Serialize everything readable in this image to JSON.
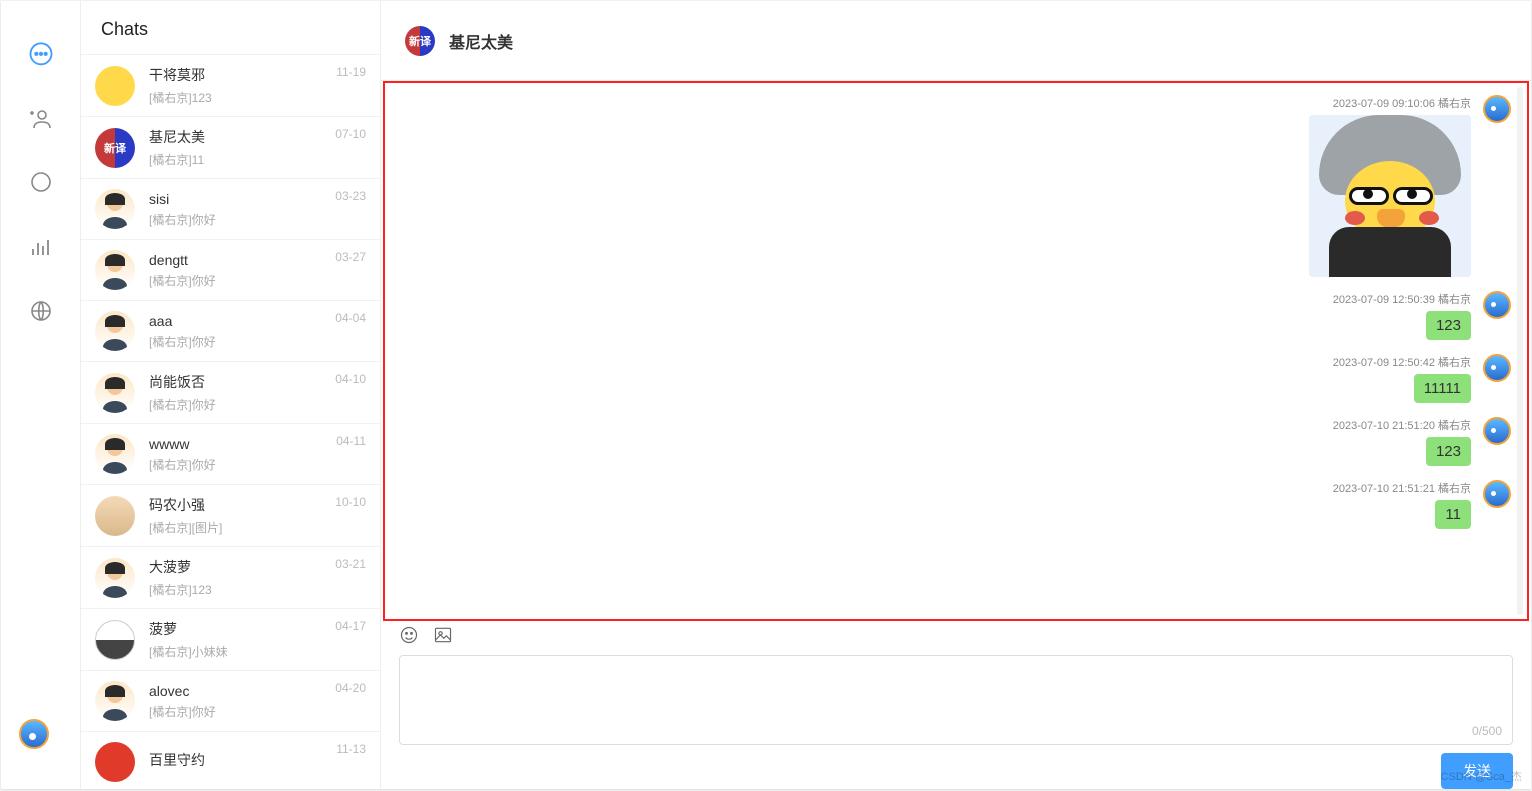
{
  "rail": {
    "icons": [
      "chat-bubble",
      "add-contact",
      "search-bubble",
      "stats",
      "globe"
    ]
  },
  "sidebar": {
    "title": "Chats",
    "items": [
      {
        "name": "干将莫邪",
        "preview": "[橘右京]123",
        "time": "11-19",
        "avatar_class": "av-yellow"
      },
      {
        "name": "基尼太美",
        "preview": "[橘右京]11",
        "time": "07-10",
        "avatar_class": "av-split",
        "avatar_text": "新译"
      },
      {
        "name": "sisi",
        "preview": "[橘右京]你好",
        "time": "03-23",
        "avatar_class": "av-person"
      },
      {
        "name": "dengtt",
        "preview": "[橘右京]你好",
        "time": "03-27",
        "avatar_class": "av-person"
      },
      {
        "name": "aaa",
        "preview": "[橘右京]你好",
        "time": "04-04",
        "avatar_class": "av-person"
      },
      {
        "name": "尚能饭否",
        "preview": "[橘右京]你好",
        "time": "04-10",
        "avatar_class": "av-person"
      },
      {
        "name": "wwww",
        "preview": "[橘右京]你好",
        "time": "04-11",
        "avatar_class": "av-person"
      },
      {
        "name": "码农小强",
        "preview": "[橘右京][图片]",
        "time": "10-10",
        "avatar_class": "av-cat"
      },
      {
        "name": "大菠萝",
        "preview": "[橘右京]123",
        "time": "03-21",
        "avatar_class": "av-person"
      },
      {
        "name": "菠萝",
        "preview": "[橘右京]小妹妹",
        "time": "04-17",
        "avatar_class": "av-half"
      },
      {
        "name": "alovec",
        "preview": "[橘右京]你好",
        "time": "04-20",
        "avatar_class": "av-person"
      },
      {
        "name": "百里守约",
        "preview": "",
        "time": "11-13",
        "avatar_class": "av-red"
      }
    ]
  },
  "main": {
    "title": "基尼太美",
    "header_avatar_class": "av-split",
    "header_avatar_text": "新译",
    "messages": [
      {
        "meta": "2023-07-09 09:10:06 橘右京",
        "kind": "image"
      },
      {
        "meta": "2023-07-09 12:50:39 橘右京",
        "kind": "text",
        "text": "123"
      },
      {
        "meta": "2023-07-09 12:50:42 橘右京",
        "kind": "text",
        "text": "11111"
      },
      {
        "meta": "2023-07-10 21:51:20 橘右京",
        "kind": "text",
        "text": "123"
      },
      {
        "meta": "2023-07-10 21:51:21 橘右京",
        "kind": "text",
        "text": "11"
      }
    ],
    "counter": "0/500",
    "send_label": "发送"
  },
  "watermark": "CSDN @Sca_杰"
}
